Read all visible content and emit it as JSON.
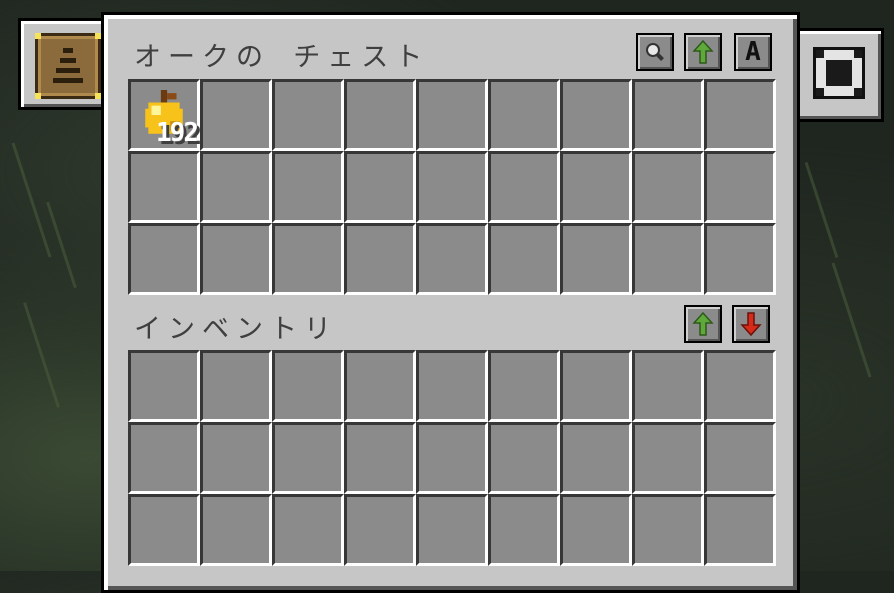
{
  "chest": {
    "title": "オークの チェスト",
    "buttons": {
      "search_icon": "search-icon",
      "sort_icon": "up-arrow-icon",
      "alpha_icon": "letter-a-icon",
      "alpha_label": "A"
    },
    "rows": 3,
    "cols": 9,
    "items": [
      {
        "slot": 0,
        "name": "golden-apple",
        "count": "192"
      }
    ]
  },
  "inventory": {
    "title": "インベントリ",
    "buttons": {
      "up_icon": "green-up-arrow-icon",
      "down_icon": "red-down-arrow-icon"
    },
    "rows": 3,
    "cols": 9
  },
  "tabs": {
    "left_icon": "chest-tab-icon",
    "right_icon": "crafting-frame-icon"
  },
  "colors": {
    "panel": "#c6c6c6",
    "slot": "#8b8b8b",
    "title_text": "#3f3f3f",
    "arrow_green": "#5fa83b",
    "arrow_red": "#d62a1a",
    "gold": "#f7e35a"
  }
}
